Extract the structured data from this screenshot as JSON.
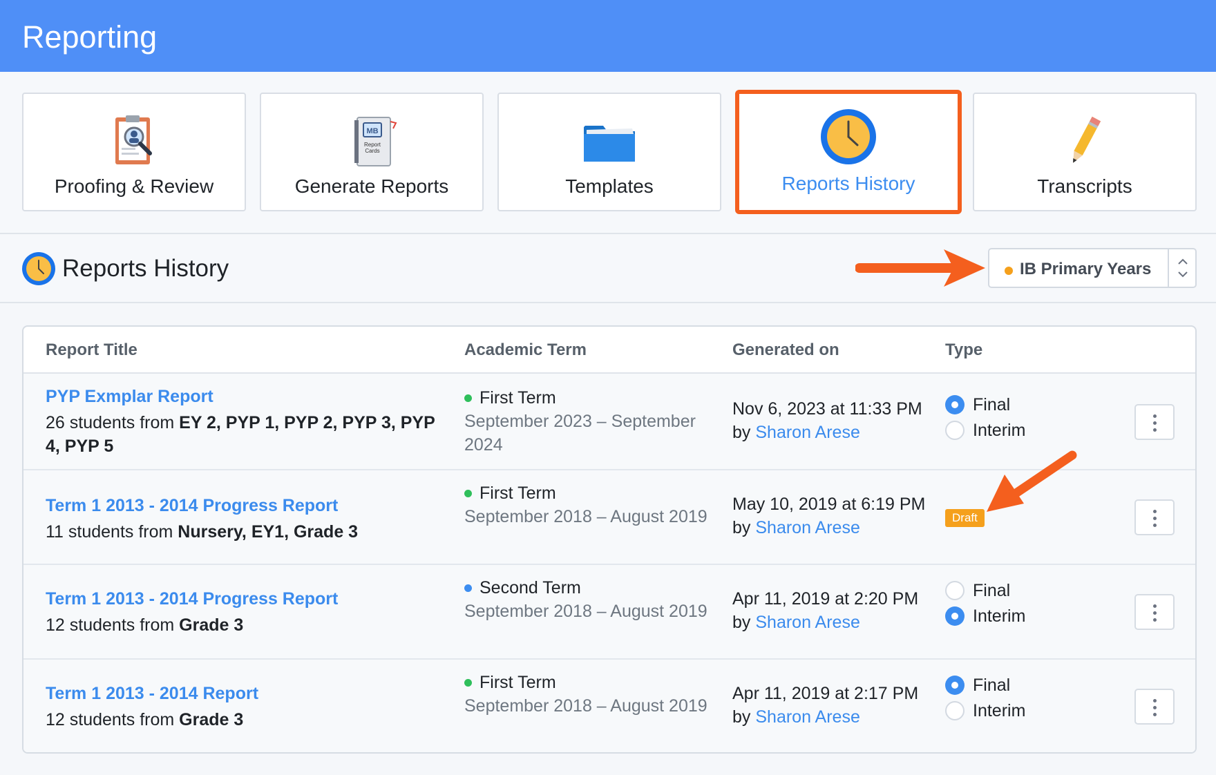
{
  "header": {
    "title": "Reporting"
  },
  "tiles": [
    {
      "label": "Proofing & Review",
      "icon": "proofing-clipboard-icon"
    },
    {
      "label": "Generate Reports",
      "icon": "report-cards-book-icon"
    },
    {
      "label": "Templates",
      "icon": "folder-icon"
    },
    {
      "label": "Reports History",
      "icon": "clock-icon",
      "active": true
    },
    {
      "label": "Transcripts",
      "icon": "pencil-icon"
    }
  ],
  "section": {
    "title": "Reports History",
    "program_select": {
      "value": "IB Primary Years",
      "dot_color": "#f5a01c"
    }
  },
  "table": {
    "headers": [
      "Report Title",
      "Academic Term",
      "Generated on",
      "Type"
    ],
    "rows": [
      {
        "title": "PYP Exmplar Report",
        "count_text": "26 students from ",
        "grades": "EY 2, PYP 1, PYP 2, PYP 3, PYP 4, PYP 5",
        "term": "First Term",
        "term_color": "#2fbf5b",
        "term_range": "September 2023 – September 2024",
        "generated": "Nov 6, 2023 at 11:33 PM",
        "by": "by ",
        "user": "Sharon Arese",
        "final_label": "Final",
        "interim_label": "Interim",
        "selected": "Final"
      },
      {
        "title": "Term 1 2013 - 2014 Progress Report",
        "count_text": "11 students from ",
        "grades": "Nursery, EY1, Grade 3",
        "term": "First Term",
        "term_color": "#2fbf5b",
        "term_range": "September 2018 – August 2019",
        "generated": "May 10, 2019 at 6:19 PM",
        "by": "by ",
        "user": "Sharon Arese",
        "badge": "Draft"
      },
      {
        "title": "Term 1 2013 - 2014 Progress Report",
        "count_text": "12 students from ",
        "grades": "Grade 3",
        "term": "Second Term",
        "term_color": "#3c8df0",
        "term_range": "September 2018 – August 2019",
        "generated": "Apr 11, 2019 at 2:20 PM",
        "by": "by ",
        "user": "Sharon Arese",
        "final_label": "Final",
        "interim_label": "Interim",
        "selected": "Interim"
      },
      {
        "title": "Term 1 2013 - 2014 Report",
        "count_text": "12 students from ",
        "grades": "Grade 3",
        "term": "First Term",
        "term_color": "#2fbf5b",
        "term_range": "September 2018 – August 2019",
        "generated": "Apr 11, 2019 at 2:17 PM",
        "by": "by ",
        "user": "Sharon Arese",
        "final_label": "Final",
        "interim_label": "Interim",
        "selected": "Final"
      }
    ]
  },
  "colors": {
    "header_bg": "#4f8ff7",
    "accent": "#3b8bed",
    "highlight": "#f45f1e",
    "draft": "#f5a01c"
  }
}
